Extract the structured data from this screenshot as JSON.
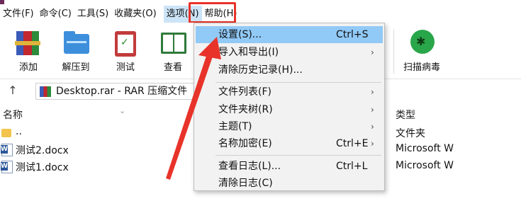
{
  "menubar": {
    "items": [
      "文件(F)",
      "命令(C)",
      "工具(S)",
      "收藏夹(O)",
      "选项(N)",
      "帮助(H)"
    ]
  },
  "toolbar": {
    "buttons": [
      {
        "label": "添加",
        "icon": "add-archive-icon"
      },
      {
        "label": "解压到",
        "icon": "extract-folder-icon"
      },
      {
        "label": "测试",
        "icon": "test-clipboard-icon"
      },
      {
        "label": "查看",
        "icon": "view-book-icon"
      },
      {
        "label": "扫描病毒",
        "icon": "virus-scan-icon"
      }
    ]
  },
  "address": {
    "path": "Desktop.rar - RAR 压缩文件"
  },
  "filelist": {
    "columns": {
      "name": "名称",
      "type": "类型"
    },
    "rows": [
      {
        "name": "..",
        "type": "文件夹",
        "icon": "folder-icon"
      },
      {
        "name": "测试2.docx",
        "type": "Microsoft W",
        "icon": "word-doc-icon"
      },
      {
        "name": "测试1.docx",
        "type": "Microsoft W",
        "icon": "word-doc-icon"
      }
    ]
  },
  "options_menu": {
    "items": [
      {
        "label": "设置(S)...",
        "shortcut": "Ctrl+S",
        "submenu": false
      },
      {
        "label": "导入和导出(I)",
        "shortcut": "",
        "submenu": true
      },
      {
        "label": "清除历史记录(H)...",
        "shortcut": "",
        "submenu": false
      },
      {
        "label": "文件列表(F)",
        "shortcut": "",
        "submenu": true
      },
      {
        "label": "文件夹树(R)",
        "shortcut": "",
        "submenu": true
      },
      {
        "label": "主题(T)",
        "shortcut": "",
        "submenu": true
      },
      {
        "label": "名称加密(E)",
        "shortcut": "Ctrl+E",
        "submenu": true
      },
      {
        "label": "查看日志(L)...",
        "shortcut": "Ctrl+L",
        "submenu": false
      },
      {
        "label": "清除日志(C)",
        "shortcut": "",
        "submenu": false
      }
    ]
  },
  "colors": {
    "highlight_box": "#e8332a",
    "annotation_arrow": "#e8332a",
    "menu_hover": "#91c9f7",
    "menu_active": "#cce4f7"
  }
}
